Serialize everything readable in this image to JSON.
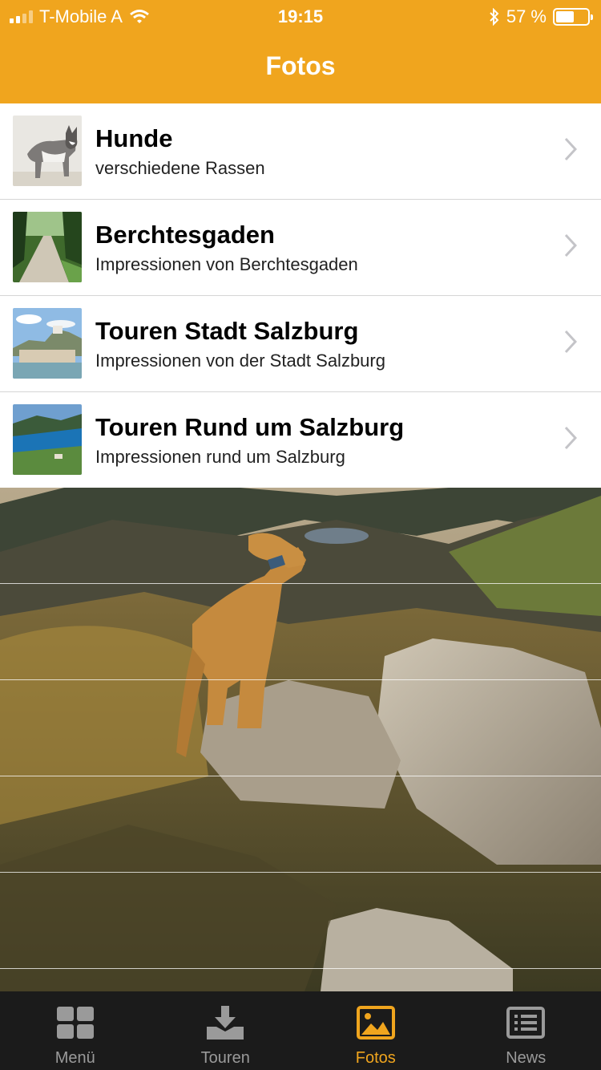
{
  "status_bar": {
    "carrier": "T-Mobile A",
    "time": "19:15",
    "battery": "57 %",
    "battery_level": 0.57
  },
  "header": {
    "title": "Fotos"
  },
  "albums": [
    {
      "title": "Hunde",
      "subtitle": "verschiedene Rassen"
    },
    {
      "title": "Berchtesgaden",
      "subtitle": "Impressionen von Berchtesgaden"
    },
    {
      "title": "Touren Stadt Salzburg",
      "subtitle": "Impressionen von der Stadt Salzburg"
    },
    {
      "title": "Touren Rund um Salzburg",
      "subtitle": "Impressionen rund um Salzburg"
    }
  ],
  "tabs": [
    {
      "label": "Menü",
      "icon": "grid-icon",
      "active": false
    },
    {
      "label": "Touren",
      "icon": "download-icon",
      "active": false
    },
    {
      "label": "Fotos",
      "icon": "photo-icon",
      "active": true
    },
    {
      "label": "News",
      "icon": "news-icon",
      "active": false
    }
  ],
  "colors": {
    "accent": "#f0a51e",
    "tabbar": "#1b1b1b",
    "inactive": "#9a9a9a"
  }
}
